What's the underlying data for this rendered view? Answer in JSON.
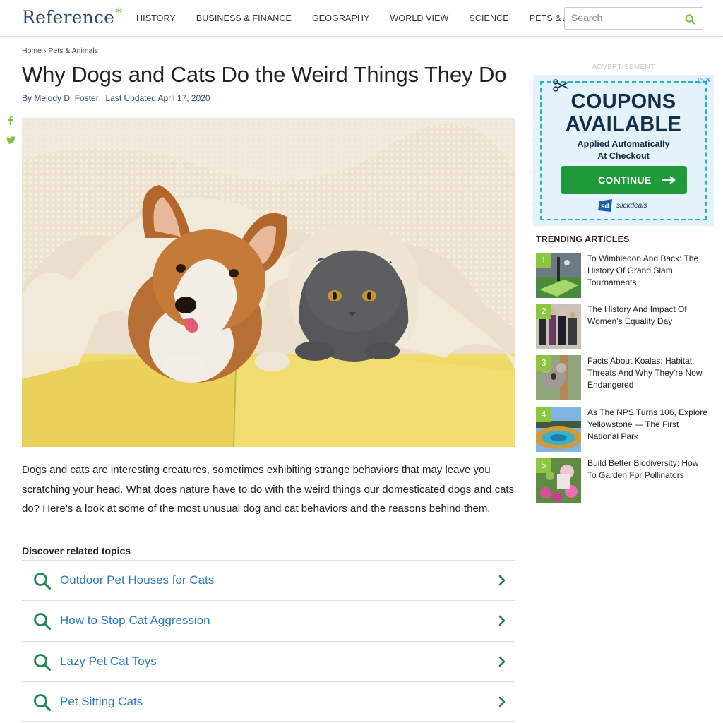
{
  "header": {
    "logo_text": "Reference",
    "logo_mark": "*",
    "nav": [
      "HISTORY",
      "BUSINESS & FINANCE",
      "GEOGRAPHY",
      "WORLD VIEW",
      "SCIENCE",
      "PETS & ANIMALS"
    ],
    "search_placeholder": "Search"
  },
  "social": {
    "icons": [
      "facebook-icon",
      "twitter-icon"
    ],
    "color": "#7cc242"
  },
  "breadcrumb": {
    "home": "Home",
    "separator": "›",
    "section": "Pets & Animals"
  },
  "article": {
    "title": "Why Dogs and Cats Do the Weird Things They Do",
    "byline": "By Melody D. Foster | Last Updated April 17, 2020",
    "intro": "Dogs and cats are interesting creatures, sometimes exhibiting strange behaviors that may leave you scratching your head. What does nature have to do with the weird things our domesticated dogs and cats do? Here’s a look at some of the most unusual dog and cat behaviors and the reasons behind them."
  },
  "related": {
    "title": "Discover related topics",
    "items": [
      {
        "label": "Outdoor Pet Houses for Cats"
      },
      {
        "label": "How to Stop Cat Aggression"
      },
      {
        "label": "Lazy Pet Cat Toys"
      },
      {
        "label": "Pet Sitting Cats"
      }
    ]
  },
  "ad": {
    "label": "ADVERTISEMENT",
    "headline_1": "COUPONS",
    "headline_2": "AVAILABLE",
    "sub_1": "Applied Automatically",
    "sub_2": "At Checkout",
    "cta": "CONTINUE",
    "brand": "slickdeals",
    "brand_mark": "sd",
    "choices_mark": "▷✕"
  },
  "trending": {
    "title": "TRENDING ARTICLES",
    "items": [
      {
        "num": "1",
        "title": "To Wimbledon And Back: The History Of Grand Slam Tournaments"
      },
      {
        "num": "2",
        "title": "The History And Impact Of Women’s Equality Day"
      },
      {
        "num": "3",
        "title": "Facts About Koalas: Habitat, Threats And Why They’re Now Endangered"
      },
      {
        "num": "4",
        "title": "As The NPS Turns 106, Explore Yellowstone — The First National Park"
      },
      {
        "num": "5",
        "title": "Build Better Biodiversity: How To Garden For Pollinators"
      }
    ]
  },
  "colors": {
    "accent_green": "#7cc242",
    "link_blue": "#2b79c2",
    "search_green": "#1f8a4c",
    "navy": "#2d4a64"
  }
}
